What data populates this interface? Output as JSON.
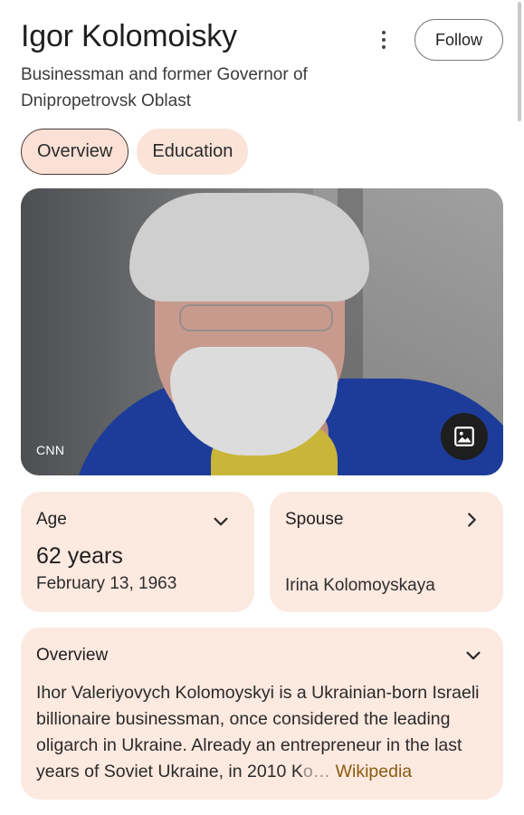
{
  "header": {
    "title": "Igor Kolomoisky",
    "subtitle": "Businessman and former Governor of Dnipropetrovsk Oblast",
    "follow_label": "Follow",
    "more_icon": "more-vert-icon"
  },
  "tabs": [
    {
      "label": "Overview",
      "active": true
    },
    {
      "label": "Education",
      "active": false
    }
  ],
  "hero": {
    "credit": "CNN",
    "image_button_icon": "image-icon"
  },
  "cards": {
    "age": {
      "label": "Age",
      "value": "62 years",
      "detail": "February 13, 1963",
      "icon": "chevron-down-icon"
    },
    "spouse": {
      "label": "Spouse",
      "value": "Irina Kolomoyskaya",
      "icon": "chevron-right-icon"
    },
    "overview": {
      "label": "Overview",
      "icon": "chevron-down-icon",
      "text": "Ihor Valeriyovych Kolomoyskyi is a Ukrainian-born Israeli billionaire businessman, once considered the leading oligarch in Ukraine. Already an entrepreneur in the last years of Soviet Ukraine, in 2010 K",
      "faded": "o…",
      "source": "Wikipedia"
    }
  },
  "colors": {
    "card_bg": "#fce9df",
    "tab_bg": "#fbe3d8",
    "link": "#8a5a10"
  }
}
